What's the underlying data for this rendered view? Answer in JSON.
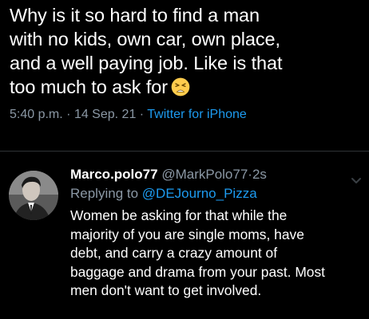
{
  "tweet": {
    "text": "Why is it so hard to find a man\nwith no kids, own car, own place,\nand a well paying job. Like is that\ntoo much to ask for",
    "emoji": "tired-face-emoji",
    "time": "5:40 p.m.",
    "separator": "·",
    "date": "14 Sep. 21",
    "source": "Twitter for iPhone"
  },
  "reply": {
    "display_name": "Marco.polo77",
    "handle": "@MarkPolo77",
    "separator": "·",
    "time": "2s",
    "replying_prefix": "Replying to ",
    "replying_to": "@DEJourno_Pizza",
    "text": "Women be asking for that while the\nmajority of you are single moms, have\ndebt, and carry a crazy amount of\nbaggage and drama from your past. Most\nmen don't want to get involved.",
    "more_icon": "chevron-down-icon"
  },
  "colors": {
    "background": "#000000",
    "text": "#ffffff",
    "muted": "#8b98a5",
    "link": "#1d9bf0"
  }
}
